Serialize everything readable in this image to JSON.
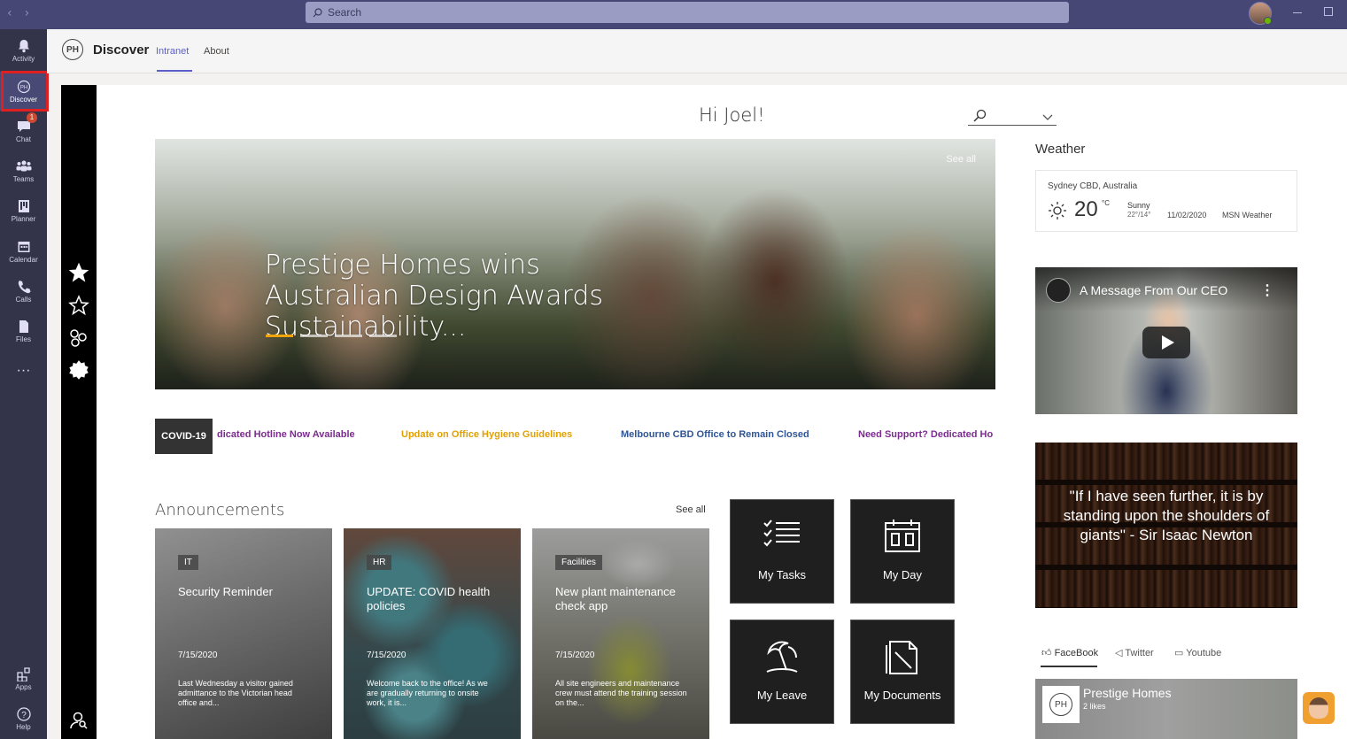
{
  "titlebar": {
    "search_placeholder": "Search"
  },
  "rail": {
    "items": [
      {
        "label": "Activity",
        "icon": "bell-icon"
      },
      {
        "label": "Discover",
        "icon": "ph-logo-icon"
      },
      {
        "label": "Chat",
        "icon": "chat-icon",
        "badge": "1"
      },
      {
        "label": "Teams",
        "icon": "teams-icon"
      },
      {
        "label": "Planner",
        "icon": "planner-icon"
      },
      {
        "label": "Calendar",
        "icon": "calendar-icon"
      },
      {
        "label": "Calls",
        "icon": "phone-icon"
      },
      {
        "label": "Files",
        "icon": "file-icon"
      }
    ],
    "more": "···",
    "apps_label": "Apps",
    "help_label": "Help"
  },
  "app": {
    "logo": "PH",
    "title": "Discover",
    "tabs": [
      "Intranet",
      "About"
    ]
  },
  "greeting": "Hi Joel!",
  "hero": {
    "title": "Prestige Homes wins Australian Design Awards Sustainability...",
    "see_all": "See all",
    "slide_count": 4,
    "active_slide": 1
  },
  "ticker": {
    "tag": "COVID-19",
    "items": [
      {
        "text": "dicated Hotline Now Available",
        "color": "#7b2c8f"
      },
      {
        "text": "Update on Office Hygiene Guidelines",
        "color": "#e0a000"
      },
      {
        "text": "Melbourne CBD Office to Remain Closed",
        "color": "#2f5597"
      },
      {
        "text": "Need Support? Dedicated Ho",
        "color": "#7b2c8f"
      }
    ]
  },
  "announcements": {
    "title": "Announcements",
    "see_all": "See all",
    "cards": [
      {
        "tag": "IT",
        "title": "Security Reminder",
        "date": "7/15/2020",
        "desc": "Last Wednesday a visitor gained admittance to the Victorian head office and..."
      },
      {
        "tag": "HR",
        "title": "UPDATE: COVID health policies",
        "date": "7/15/2020",
        "desc": "Welcome back to the office! As we are gradually returning to onsite work, it is..."
      },
      {
        "tag": "Facilities",
        "title": "New plant maintenance check app",
        "date": "7/15/2020",
        "desc": "All site engineers and maintenance crew must attend the training session on the..."
      }
    ]
  },
  "tiles": [
    {
      "label": "My Tasks",
      "icon": "task-list-icon"
    },
    {
      "label": "My Day",
      "icon": "calendar-day-icon"
    },
    {
      "label": "My Leave",
      "icon": "beach-umbrella-icon"
    },
    {
      "label": "My Documents",
      "icon": "documents-icon"
    }
  ],
  "weather": {
    "title": "Weather",
    "location": "Sydney CBD, Australia",
    "temp": "20",
    "unit": "°C",
    "condition": "Sunny",
    "range": "22°/14°",
    "date": "11/02/2020",
    "source": "MSN Weather"
  },
  "video": {
    "title": "A Message From Our CEO"
  },
  "quote": {
    "text": "\"If I have seen further, it is by standing upon the shoulders of giants\" - Sir Isaac Newton"
  },
  "social": {
    "tabs": [
      "FaceBook",
      "Twitter",
      "Youtube"
    ],
    "page_name": "Prestige Homes",
    "likes": "2 likes",
    "logo": "PH"
  }
}
